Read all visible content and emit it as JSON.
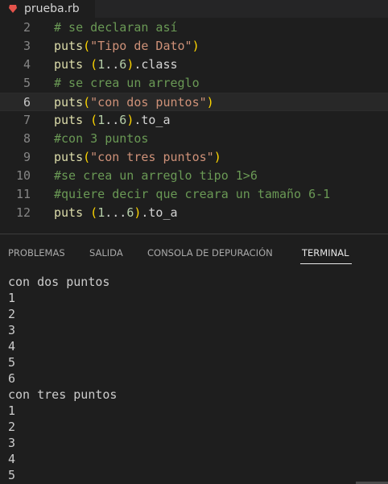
{
  "editor_tab": {
    "file_name": "prueba.rb",
    "icon": "ruby-icon",
    "icon_color": "#e5534b"
  },
  "editor": {
    "current_line": "6",
    "lines": [
      {
        "number": "2",
        "tokens": [
          {
            "t": "comment",
            "v": "# se declaran así"
          }
        ]
      },
      {
        "number": "3",
        "tokens": [
          {
            "t": "fn",
            "v": "puts"
          },
          {
            "t": "paren",
            "v": "("
          },
          {
            "t": "string",
            "v": "\"Tipo de Dato\""
          },
          {
            "t": "paren",
            "v": ")"
          }
        ]
      },
      {
        "number": "4",
        "tokens": [
          {
            "t": "fn",
            "v": "puts"
          },
          {
            "t": "plain",
            "v": " "
          },
          {
            "t": "paren",
            "v": "("
          },
          {
            "t": "num",
            "v": "1"
          },
          {
            "t": "plain",
            "v": ".."
          },
          {
            "t": "num",
            "v": "6"
          },
          {
            "t": "paren",
            "v": ")"
          },
          {
            "t": "plain",
            "v": ".class"
          }
        ]
      },
      {
        "number": "5",
        "tokens": [
          {
            "t": "comment",
            "v": "# se crea un arreglo"
          }
        ]
      },
      {
        "number": "6",
        "tokens": [
          {
            "t": "fn",
            "v": "puts"
          },
          {
            "t": "paren",
            "v": "("
          },
          {
            "t": "string",
            "v": "\"con dos puntos\""
          },
          {
            "t": "paren",
            "v": ")"
          }
        ]
      },
      {
        "number": "7",
        "tokens": [
          {
            "t": "fn",
            "v": "puts"
          },
          {
            "t": "plain",
            "v": " "
          },
          {
            "t": "paren",
            "v": "("
          },
          {
            "t": "num",
            "v": "1"
          },
          {
            "t": "plain",
            "v": ".."
          },
          {
            "t": "num",
            "v": "6"
          },
          {
            "t": "paren",
            "v": ")"
          },
          {
            "t": "plain",
            "v": ".to_a"
          }
        ]
      },
      {
        "number": "8",
        "tokens": [
          {
            "t": "comment",
            "v": "#con 3 puntos"
          }
        ]
      },
      {
        "number": "9",
        "tokens": [
          {
            "t": "fn",
            "v": "puts"
          },
          {
            "t": "paren",
            "v": "("
          },
          {
            "t": "string",
            "v": "\"con tres puntos\""
          },
          {
            "t": "paren",
            "v": ")"
          }
        ]
      },
      {
        "number": "10",
        "tokens": [
          {
            "t": "comment",
            "v": "#se crea un arreglo tipo 1>6"
          }
        ]
      },
      {
        "number": "11",
        "tokens": [
          {
            "t": "comment",
            "v": "#quiere decir que creara un tamaño 6-1"
          }
        ]
      },
      {
        "number": "12",
        "tokens": [
          {
            "t": "fn",
            "v": "puts"
          },
          {
            "t": "plain",
            "v": " "
          },
          {
            "t": "paren",
            "v": "("
          },
          {
            "t": "num",
            "v": "1"
          },
          {
            "t": "plain",
            "v": "..."
          },
          {
            "t": "num",
            "v": "6"
          },
          {
            "t": "paren",
            "v": ")"
          },
          {
            "t": "plain",
            "v": ".to_a"
          }
        ]
      }
    ]
  },
  "panel": {
    "tabs": [
      {
        "label": "PROBLEMAS",
        "active": false
      },
      {
        "label": "SALIDA",
        "active": false
      },
      {
        "label": "CONSOLA DE DEPURACIÓN",
        "active": false
      },
      {
        "label": "TERMINAL",
        "active": true
      }
    ],
    "terminal_output": [
      "con dos puntos",
      "1",
      "2",
      "3",
      "4",
      "5",
      "6",
      "con tres puntos",
      "1",
      "2",
      "3",
      "4",
      "5"
    ]
  },
  "colors": {
    "editor_bg": "#1e1e1e",
    "comment": "#6a9955",
    "function": "#dcdcaa",
    "bracket": "#ffd700",
    "string": "#ce9178",
    "number": "#b5cea8",
    "terminal_text": "#cccccc"
  }
}
